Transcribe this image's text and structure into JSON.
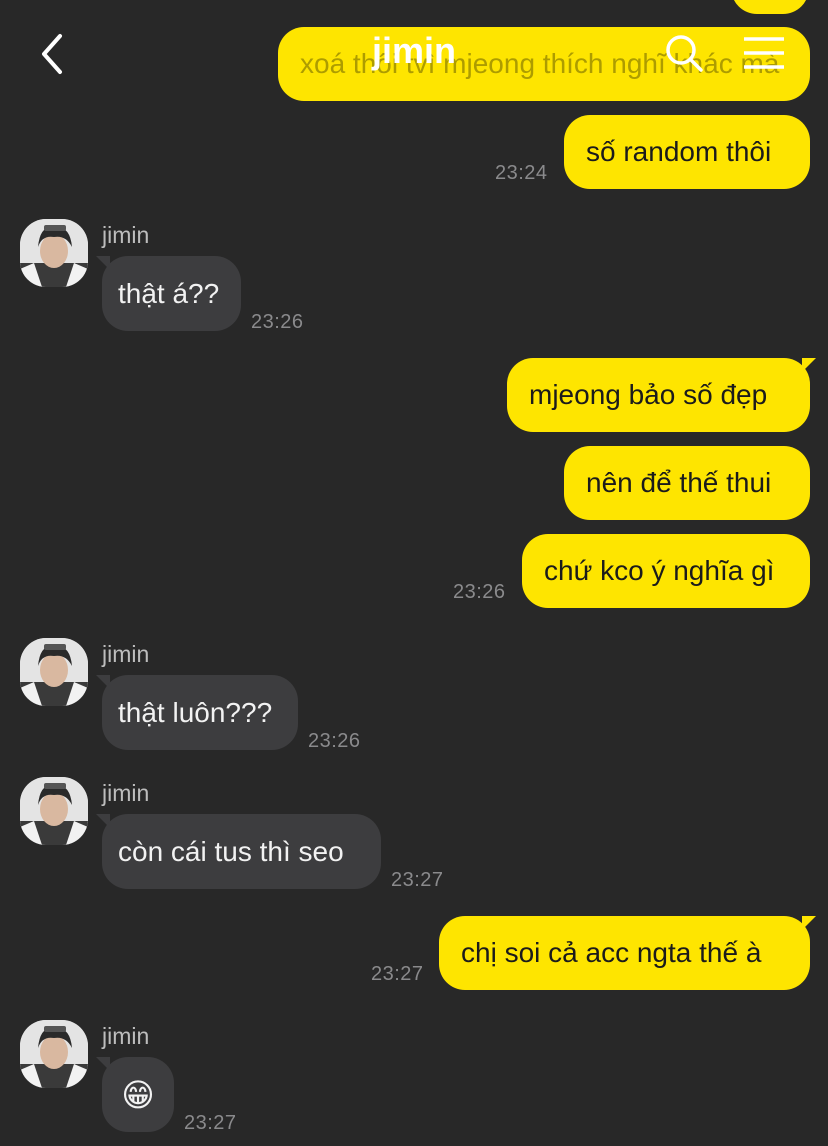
{
  "header": {
    "title": "jimin",
    "back_icon": "chevron-left-icon",
    "search_icon": "search-icon",
    "menu_icon": "menu-icon"
  },
  "colors": {
    "background": "#282828",
    "outgoing_bubble": "#FEE500",
    "incoming_bubble": "#3d3d3f",
    "timestamp": "#8a8a8c"
  },
  "messages": {
    "m0": {
      "text": "xoá thôi tvì mjeong thích nghĩ khác mà",
      "direction": "out"
    },
    "m1": {
      "text": "số random thôi",
      "direction": "out",
      "time": "23:24"
    },
    "m2": {
      "sender": "jimin",
      "text": "thật á??",
      "direction": "in",
      "time": "23:26"
    },
    "m3": {
      "text": "mjeong bảo số đẹp",
      "direction": "out"
    },
    "m4": {
      "text": "nên để thế thui",
      "direction": "out"
    },
    "m5": {
      "text": "chứ kco ý nghĩa gì",
      "direction": "out",
      "time": "23:26"
    },
    "m6": {
      "sender": "jimin",
      "text": "thật luôn???",
      "direction": "in",
      "time": "23:26"
    },
    "m7": {
      "sender": "jimin",
      "text": "còn cái tus thì seo",
      "direction": "in",
      "time": "23:27"
    },
    "m8": {
      "text": "chị soi cả acc ngta thế à",
      "direction": "out",
      "time": "23:27"
    },
    "m9": {
      "sender": "jimin",
      "text": "😁",
      "direction": "in",
      "time": "23:27"
    }
  }
}
